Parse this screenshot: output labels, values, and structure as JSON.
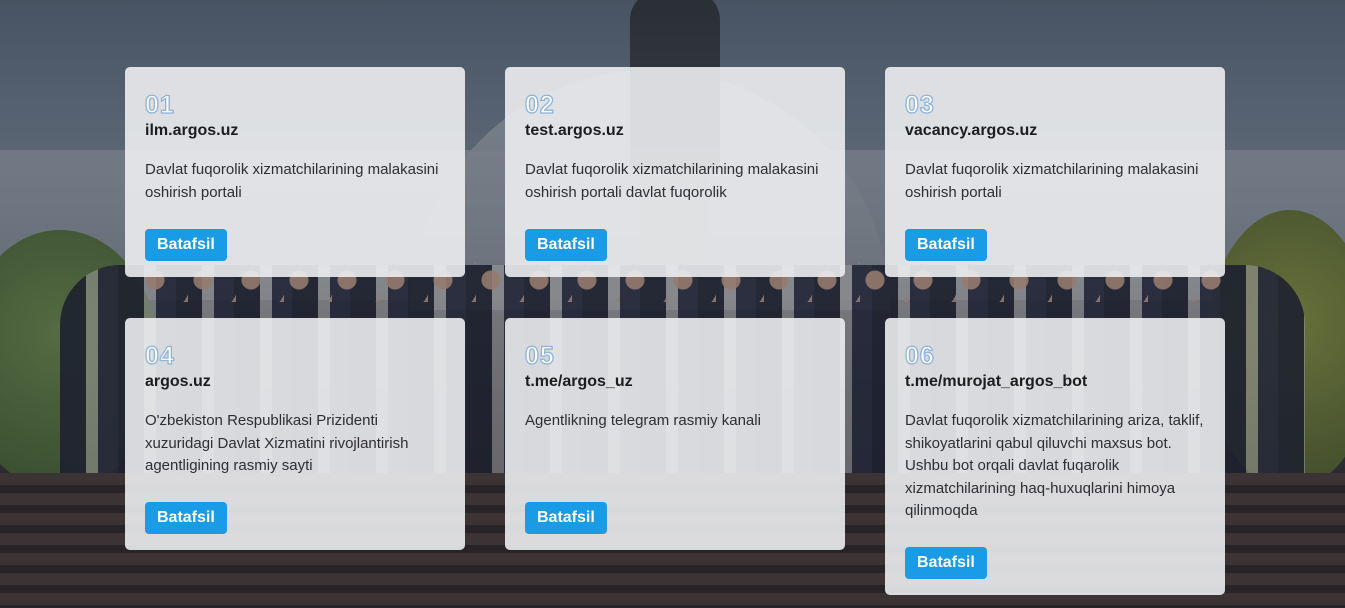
{
  "cards": [
    {
      "number": "01",
      "title": "ilm.argos.uz",
      "description": "Davlat fuqorolik xizmatchilarining malakasini oshirish portali",
      "button": "Batafsil"
    },
    {
      "number": "02",
      "title": "test.argos.uz",
      "description": "Davlat fuqorolik xizmatchilarining malakasini oshirish portali davlat fuqorolik",
      "button": "Batafsil"
    },
    {
      "number": "03",
      "title": "vacancy.argos.uz",
      "description": "Davlat fuqorolik xizmatchilarining malakasini oshirish portali",
      "button": "Batafsil"
    },
    {
      "number": "04",
      "title": "argos.uz",
      "description": "O'zbekiston Respublikasi Prizidenti xuzuridagi Davlat Xizmatini rivojlantirish agentligining rasmiy sayti",
      "button": "Batafsil"
    },
    {
      "number": "05",
      "title": "t.me/argos_uz",
      "description": "Agentlikning telegram rasmiy kanali",
      "button": "Batafsil"
    },
    {
      "number": "06",
      "title": "t.me/murojat_argos_bot",
      "description": "Davlat fuqorolik xizmatchilarining ariza, taklif, shikoyatlarini qabul qiluvchi maxsus bot. Ushbu bot orqali davlat fuqarolik xizmatchilarining haq-huxuqlarini himoya qilinmoqda",
      "button": "Batafsil"
    }
  ],
  "colors": {
    "button": "#1a9be6",
    "card_background": "#ecedf0",
    "number_outline": "#8eb4d9"
  }
}
